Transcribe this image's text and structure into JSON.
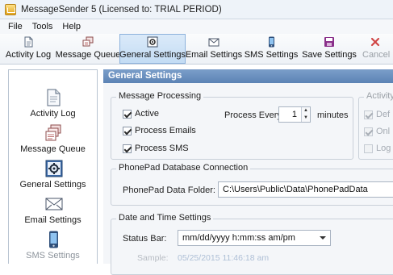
{
  "window": {
    "title": "MessageSender 5   (Licensed to: TRIAL PERIOD)"
  },
  "menu": [
    "File",
    "Tools",
    "Help"
  ],
  "toolbar": {
    "buttons": [
      {
        "label": "Activity Log",
        "icon": "document-icon"
      },
      {
        "label": "Message Queue",
        "icon": "message-queue-icon"
      },
      {
        "label": "General Settings",
        "icon": "settings-icon",
        "active": true
      },
      {
        "label": "Email Settings",
        "icon": "envelope-icon"
      },
      {
        "label": "SMS Settings",
        "icon": "phone-icon"
      },
      {
        "label": "Save Settings",
        "icon": "save-icon"
      },
      {
        "label": "Cancel",
        "icon": "close-icon",
        "disabled": true
      }
    ]
  },
  "sidebar": {
    "items": [
      {
        "label": "Activity Log",
        "icon": "document-icon"
      },
      {
        "label": "Message Queue",
        "icon": "message-queue-icon"
      },
      {
        "label": "General Settings",
        "icon": "settings-icon",
        "active": true
      },
      {
        "label": "Email Settings",
        "icon": "envelope-icon"
      },
      {
        "label": "SMS Settings",
        "icon": "phone-icon"
      }
    ]
  },
  "content": {
    "header": "General Settings",
    "message_processing": {
      "title": "Message Processing",
      "active_label": "Active",
      "process_emails_label": "Process Emails",
      "process_sms_label": "Process SMS",
      "process_every_label": "Process Every",
      "process_every_value": "1",
      "minutes_label": "minutes",
      "active_checked": true,
      "process_emails_checked": true,
      "process_sms_checked": true
    },
    "activity": {
      "title": "Activity",
      "options": [
        {
          "label": "Def",
          "checked": true
        },
        {
          "label": "Onl",
          "checked": true
        },
        {
          "label": "Log",
          "checked": false
        }
      ]
    },
    "phonepad": {
      "title": "PhonePad Database Connection",
      "folder_label": "PhonePad Data Folder:",
      "folder_value": "C:\\Users\\Public\\Data\\PhonePadData"
    },
    "datetime": {
      "title": "Date and Time Settings",
      "status_bar_label": "Status Bar:",
      "status_bar_value": "mm/dd/yyyy  h:mm:ss am/pm",
      "sample_label": "Sample:",
      "sample_value": "05/25/2015  11:46:18 am"
    }
  },
  "colors": {
    "header_bar": "#6a8fc0",
    "active_toolbar": "#c9def5",
    "save_icon": "#8a2f8a",
    "cancel_icon": "#d04545"
  }
}
